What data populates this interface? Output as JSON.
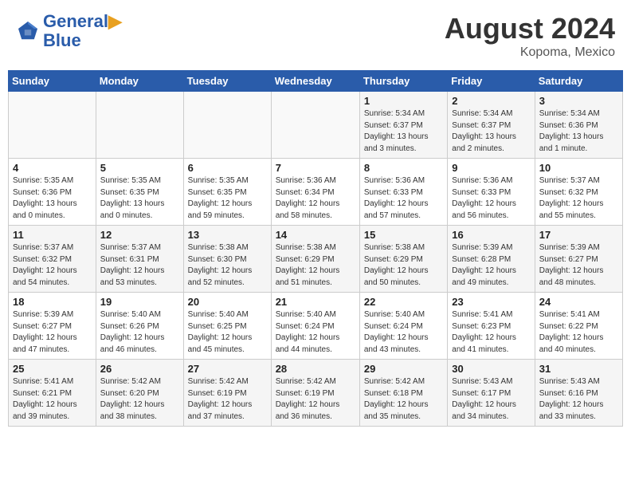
{
  "header": {
    "logo_line1": "General",
    "logo_line2": "Blue",
    "main_title": "August 2024",
    "subtitle": "Kopoma, Mexico"
  },
  "weekdays": [
    "Sunday",
    "Monday",
    "Tuesday",
    "Wednesday",
    "Thursday",
    "Friday",
    "Saturday"
  ],
  "weeks": [
    [
      {
        "day": "",
        "info": ""
      },
      {
        "day": "",
        "info": ""
      },
      {
        "day": "",
        "info": ""
      },
      {
        "day": "",
        "info": ""
      },
      {
        "day": "1",
        "info": "Sunrise: 5:34 AM\nSunset: 6:37 PM\nDaylight: 13 hours\nand 3 minutes."
      },
      {
        "day": "2",
        "info": "Sunrise: 5:34 AM\nSunset: 6:37 PM\nDaylight: 13 hours\nand 2 minutes."
      },
      {
        "day": "3",
        "info": "Sunrise: 5:34 AM\nSunset: 6:36 PM\nDaylight: 13 hours\nand 1 minute."
      }
    ],
    [
      {
        "day": "4",
        "info": "Sunrise: 5:35 AM\nSunset: 6:36 PM\nDaylight: 13 hours\nand 0 minutes."
      },
      {
        "day": "5",
        "info": "Sunrise: 5:35 AM\nSunset: 6:35 PM\nDaylight: 13 hours\nand 0 minutes."
      },
      {
        "day": "6",
        "info": "Sunrise: 5:35 AM\nSunset: 6:35 PM\nDaylight: 12 hours\nand 59 minutes."
      },
      {
        "day": "7",
        "info": "Sunrise: 5:36 AM\nSunset: 6:34 PM\nDaylight: 12 hours\nand 58 minutes."
      },
      {
        "day": "8",
        "info": "Sunrise: 5:36 AM\nSunset: 6:33 PM\nDaylight: 12 hours\nand 57 minutes."
      },
      {
        "day": "9",
        "info": "Sunrise: 5:36 AM\nSunset: 6:33 PM\nDaylight: 12 hours\nand 56 minutes."
      },
      {
        "day": "10",
        "info": "Sunrise: 5:37 AM\nSunset: 6:32 PM\nDaylight: 12 hours\nand 55 minutes."
      }
    ],
    [
      {
        "day": "11",
        "info": "Sunrise: 5:37 AM\nSunset: 6:32 PM\nDaylight: 12 hours\nand 54 minutes."
      },
      {
        "day": "12",
        "info": "Sunrise: 5:37 AM\nSunset: 6:31 PM\nDaylight: 12 hours\nand 53 minutes."
      },
      {
        "day": "13",
        "info": "Sunrise: 5:38 AM\nSunset: 6:30 PM\nDaylight: 12 hours\nand 52 minutes."
      },
      {
        "day": "14",
        "info": "Sunrise: 5:38 AM\nSunset: 6:29 PM\nDaylight: 12 hours\nand 51 minutes."
      },
      {
        "day": "15",
        "info": "Sunrise: 5:38 AM\nSunset: 6:29 PM\nDaylight: 12 hours\nand 50 minutes."
      },
      {
        "day": "16",
        "info": "Sunrise: 5:39 AM\nSunset: 6:28 PM\nDaylight: 12 hours\nand 49 minutes."
      },
      {
        "day": "17",
        "info": "Sunrise: 5:39 AM\nSunset: 6:27 PM\nDaylight: 12 hours\nand 48 minutes."
      }
    ],
    [
      {
        "day": "18",
        "info": "Sunrise: 5:39 AM\nSunset: 6:27 PM\nDaylight: 12 hours\nand 47 minutes."
      },
      {
        "day": "19",
        "info": "Sunrise: 5:40 AM\nSunset: 6:26 PM\nDaylight: 12 hours\nand 46 minutes."
      },
      {
        "day": "20",
        "info": "Sunrise: 5:40 AM\nSunset: 6:25 PM\nDaylight: 12 hours\nand 45 minutes."
      },
      {
        "day": "21",
        "info": "Sunrise: 5:40 AM\nSunset: 6:24 PM\nDaylight: 12 hours\nand 44 minutes."
      },
      {
        "day": "22",
        "info": "Sunrise: 5:40 AM\nSunset: 6:24 PM\nDaylight: 12 hours\nand 43 minutes."
      },
      {
        "day": "23",
        "info": "Sunrise: 5:41 AM\nSunset: 6:23 PM\nDaylight: 12 hours\nand 41 minutes."
      },
      {
        "day": "24",
        "info": "Sunrise: 5:41 AM\nSunset: 6:22 PM\nDaylight: 12 hours\nand 40 minutes."
      }
    ],
    [
      {
        "day": "25",
        "info": "Sunrise: 5:41 AM\nSunset: 6:21 PM\nDaylight: 12 hours\nand 39 minutes."
      },
      {
        "day": "26",
        "info": "Sunrise: 5:42 AM\nSunset: 6:20 PM\nDaylight: 12 hours\nand 38 minutes."
      },
      {
        "day": "27",
        "info": "Sunrise: 5:42 AM\nSunset: 6:19 PM\nDaylight: 12 hours\nand 37 minutes."
      },
      {
        "day": "28",
        "info": "Sunrise: 5:42 AM\nSunset: 6:19 PM\nDaylight: 12 hours\nand 36 minutes."
      },
      {
        "day": "29",
        "info": "Sunrise: 5:42 AM\nSunset: 6:18 PM\nDaylight: 12 hours\nand 35 minutes."
      },
      {
        "day": "30",
        "info": "Sunrise: 5:43 AM\nSunset: 6:17 PM\nDaylight: 12 hours\nand 34 minutes."
      },
      {
        "day": "31",
        "info": "Sunrise: 5:43 AM\nSunset: 6:16 PM\nDaylight: 12 hours\nand 33 minutes."
      }
    ]
  ]
}
